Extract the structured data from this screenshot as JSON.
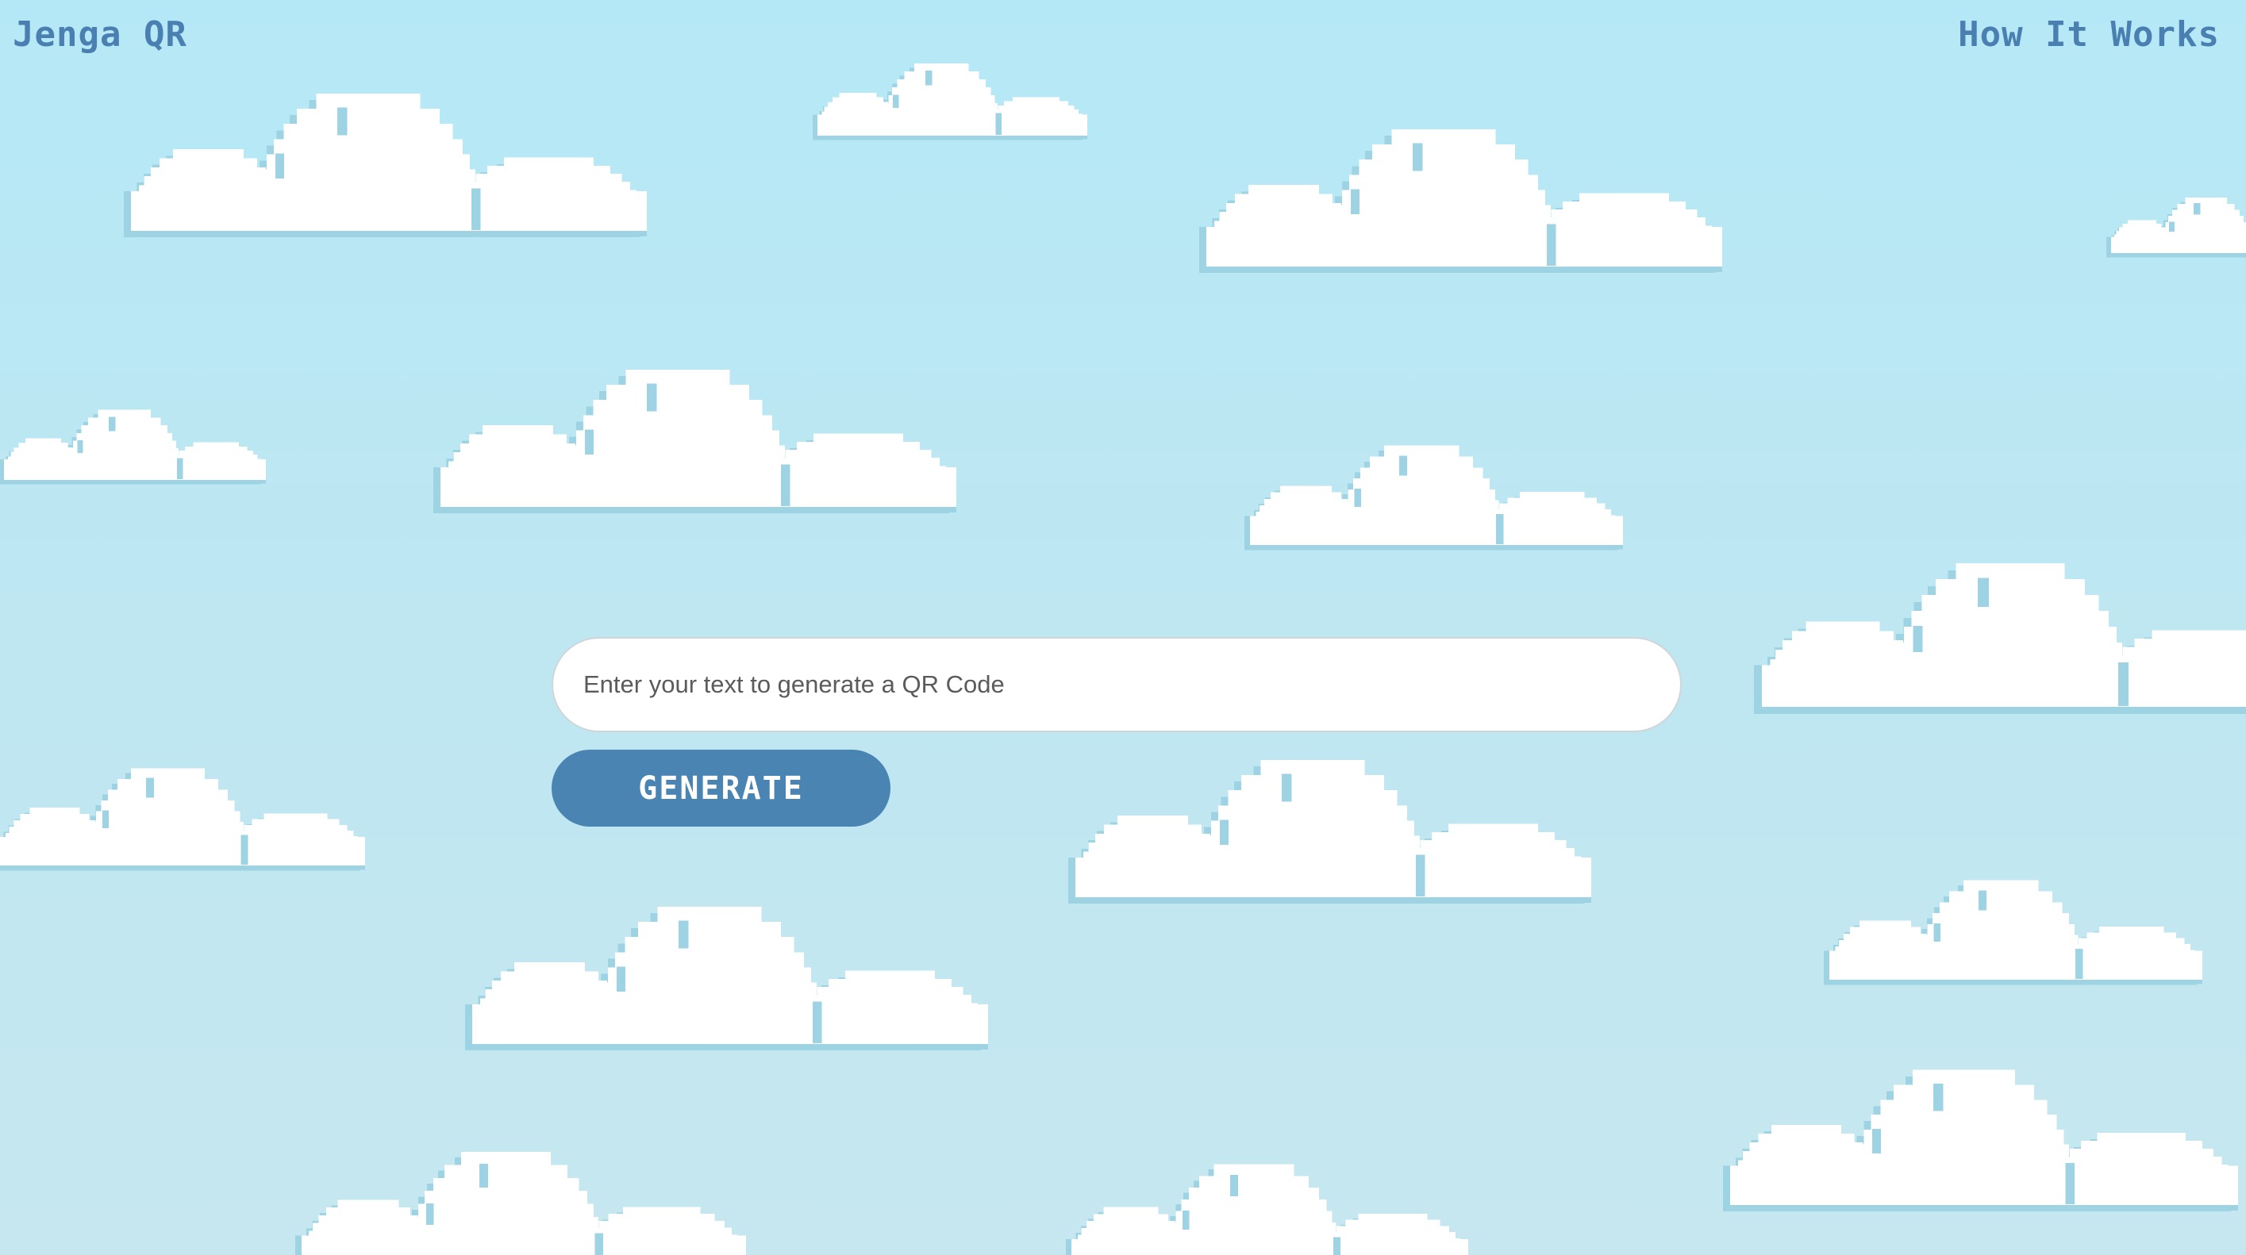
{
  "header": {
    "logo": "Jenga QR",
    "nav_link": "How It Works"
  },
  "form": {
    "input_value": "",
    "input_placeholder": "Enter your text to generate a QR Code",
    "generate_label": "GENERATE"
  },
  "colors": {
    "sky_top": "#b5e8f6",
    "sky_bottom": "#c6e7ef",
    "accent": "#4a84b2",
    "text_accent": "#4a7fb1",
    "cloud_fill": "#ffffff",
    "cloud_shadow": "#9dd3e3"
  },
  "decor": {
    "background": "pixel-clouds"
  }
}
